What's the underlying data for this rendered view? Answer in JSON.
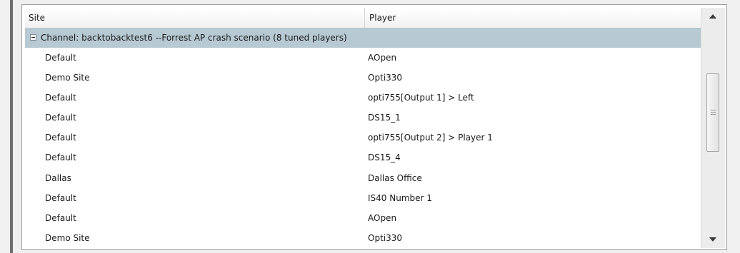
{
  "grid": {
    "columns": {
      "site": "Site",
      "player": "Player"
    },
    "group": {
      "label": "Channel: backtobacktest6 --Forrest AP crash scenario (8 tuned players)"
    },
    "rows": [
      {
        "site": "Default",
        "player": "AOpen"
      },
      {
        "site": "Demo Site",
        "player": "Opti330"
      },
      {
        "site": "Default",
        "player": "opti755[Output 1] > Left"
      },
      {
        "site": "Default",
        "player": "DS15_1"
      },
      {
        "site": "Default",
        "player": "opti755[Output 2] > Player 1"
      },
      {
        "site": "Default",
        "player": "DS15_4"
      },
      {
        "site": "Dallas",
        "player": "Dallas Office"
      },
      {
        "site": "Default",
        "player": "IS40 Number 1"
      },
      {
        "site": "Default",
        "player": "AOpen"
      },
      {
        "site": "Demo Site",
        "player": "Opti330"
      }
    ]
  },
  "icons": {
    "collapse": "collapse-minus-icon",
    "scroll_up": "scroll-up-arrow-icon",
    "scroll_down": "scroll-down-arrow-icon"
  },
  "colors": {
    "group_row_bg": "#b7c9d2",
    "header_bg": "#f1f1f1"
  }
}
